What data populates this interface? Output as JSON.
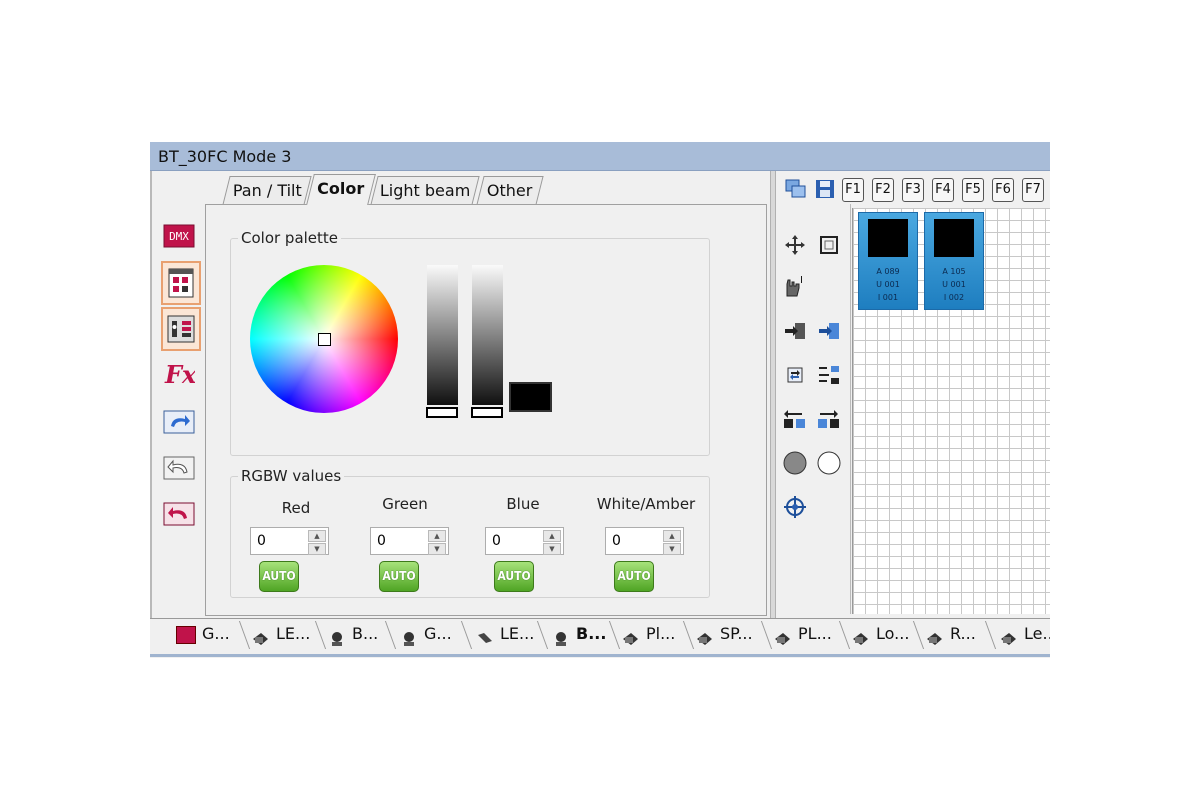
{
  "window": {
    "title": "BT_30FC Mode 3"
  },
  "left_toolbar": [
    {
      "name": "dmx-icon",
      "label": "DMX"
    },
    {
      "name": "palette-grid-icon"
    },
    {
      "name": "fixture-channels-icon"
    },
    {
      "name": "effects-fx-icon",
      "label": "Fx"
    },
    {
      "name": "redo-icon"
    },
    {
      "name": "undo-gray-icon"
    },
    {
      "name": "undo-red-icon"
    }
  ],
  "tabs": [
    "Pan / Tilt",
    "Color",
    "Light beam",
    "Other"
  ],
  "active_tab": "Color",
  "color_palette": {
    "label": "Color palette",
    "selected_color": "#000000"
  },
  "rgbw": {
    "label": "RGBW values",
    "channels": [
      {
        "label": "Red",
        "value": "0",
        "auto": "AUTO"
      },
      {
        "label": "Green",
        "value": "0",
        "auto": "AUTO"
      },
      {
        "label": "Blue",
        "value": "0",
        "auto": "AUTO"
      },
      {
        "label": "White/Amber",
        "value": "0",
        "auto": "AUTO"
      }
    ]
  },
  "right_toolbar": {
    "function_keys": [
      "F1",
      "F2",
      "F3",
      "F4",
      "F5",
      "F6",
      "F7"
    ]
  },
  "fixtures": [
    {
      "a": "A 089",
      "u": "U 001",
      "i": "I 001"
    },
    {
      "a": "A 105",
      "u": "U 001",
      "i": "I 002"
    }
  ],
  "bottom_tabs": [
    {
      "label": "G...",
      "icon": "group-icon"
    },
    {
      "label": "LE...",
      "icon": "spotlight-icon"
    },
    {
      "label": "B...",
      "icon": "moving-head-icon"
    },
    {
      "label": "G...",
      "icon": "moving-head-icon"
    },
    {
      "label": "LE...",
      "icon": "scanner-icon"
    },
    {
      "label": "B...",
      "icon": "moving-head-icon",
      "active": true
    },
    {
      "label": "Pl...",
      "icon": "spotlight-icon"
    },
    {
      "label": "SP...",
      "icon": "spotlight-icon"
    },
    {
      "label": "PL...",
      "icon": "spotlight-icon"
    },
    {
      "label": "Lo...",
      "icon": "spotlight-icon"
    },
    {
      "label": "R...",
      "icon": "spotlight-icon"
    },
    {
      "label": "Le...",
      "icon": "spotlight-icon"
    }
  ],
  "colors": {
    "titlebar": "#a8bcd8",
    "fixture_blue": "#2b8fd0",
    "auto_green": "#5cb32e",
    "accent_red": "#c0134a"
  }
}
